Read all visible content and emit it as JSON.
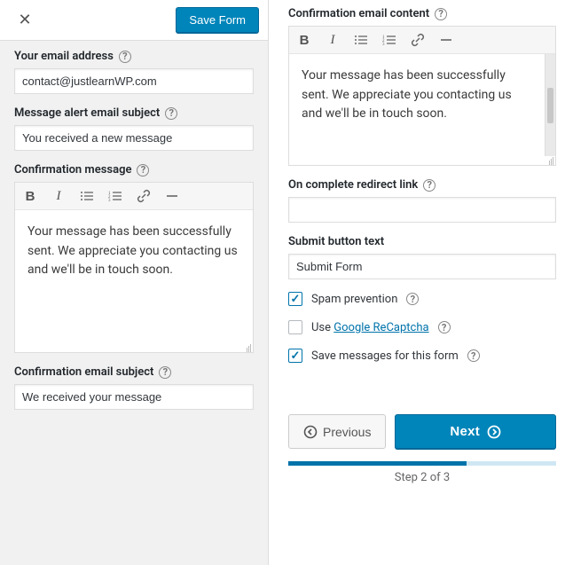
{
  "topbar": {
    "save_label": "Save Form"
  },
  "left": {
    "email_label": "Your email address",
    "email_value": "contact@justlearnWP.com",
    "subject_label": "Message alert email subject",
    "subject_value": "You received a new message",
    "confirm_label": "Confirmation message",
    "confirm_value": "Your message has been successfully sent. We appreciate you contacting us and we'll be in touch soon.",
    "conf_subject_label": "Confirmation email subject",
    "conf_subject_value": "We received your message"
  },
  "right": {
    "conf_content_label": "Confirmation email content",
    "conf_content_value": "Your message has been successfully sent. We appreciate you contacting us and we'll be in touch soon.",
    "redirect_label": "On complete redirect link",
    "redirect_value": "",
    "submit_label": "Submit button text",
    "submit_value": "Submit Form",
    "spam_label": "Spam prevention",
    "recaptcha_prefix": "Use",
    "recaptcha_link": "Google ReCaptcha",
    "save_msgs_label": "Save messages for this form",
    "previous_label": "Previous",
    "next_label": "Next",
    "step_label": "Step 2 of 3"
  }
}
